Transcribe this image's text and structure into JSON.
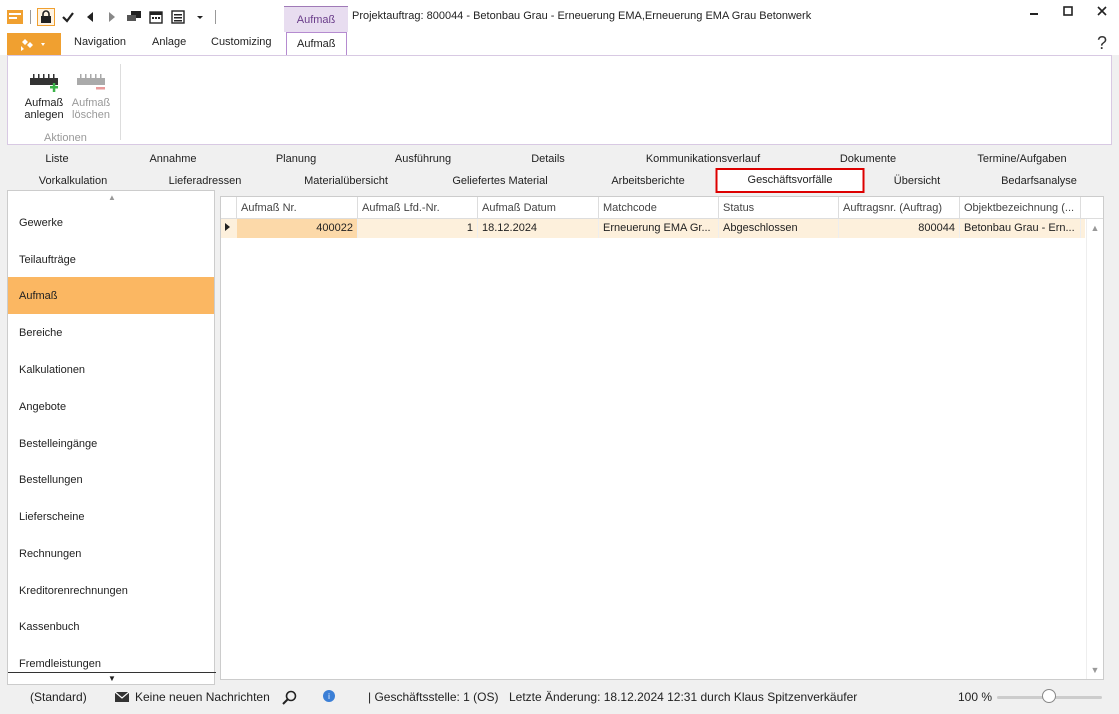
{
  "window": {
    "context_group": "Aufmaß",
    "title": "Projektauftrag: 800044 - Betonbau Grau - Erneuerung EMA,Erneuerung EMA Grau Betonwerk",
    "icons": [
      "app-icon",
      "lock-icon",
      "check-icon",
      "back-icon",
      "forward-icon",
      "chat-icon",
      "calendar-icon",
      "list-icon",
      "dropdown-icon"
    ],
    "controls": [
      "minimize-icon",
      "maximize-icon",
      "close-icon"
    ]
  },
  "ribbon": {
    "tabs": [
      "Navigation",
      "Anlage",
      "Customizing",
      "Aufmaß"
    ],
    "active_tab": "Aufmaß",
    "help": "?",
    "buttons": [
      {
        "label_1": "Aufmaß",
        "label_2": "anlegen",
        "enabled": true
      },
      {
        "label_1": "Aufmaß",
        "label_2": "löschen",
        "enabled": false
      }
    ],
    "group_label": "Aktionen"
  },
  "nav": {
    "row1": [
      "Liste",
      "Annahme",
      "Planung",
      "Ausführung",
      "Details",
      "Kommunikationsverlauf",
      "Dokumente",
      "Termine/Aufgaben"
    ],
    "row2": [
      "Vorkalkulation",
      "Lieferadressen",
      "Materialübersicht",
      "Geliefertes Material",
      "Arbeitsberichte",
      "Geschäftsvorfälle",
      "Übersicht",
      "Bedarfsanalyse"
    ],
    "selected": "Geschäftsvorfälle"
  },
  "sidebar": {
    "items": [
      "Gewerke",
      "Teilaufträge",
      "Aufmaß",
      "Bereiche",
      "Kalkulationen",
      "Angebote",
      "Bestelleingänge",
      "Bestellungen",
      "Lieferscheine",
      "Rechnungen",
      "Kreditorenrechnungen",
      "Kassenbuch",
      "Fremdleistungen"
    ],
    "active": "Aufmaß"
  },
  "grid": {
    "columns": [
      "Aufmaß Nr.",
      "Aufmaß Lfd.-Nr.",
      "Aufmaß Datum",
      "Matchcode",
      "Status",
      "Auftragsnr. (Auftrag)",
      "Objektbezeichnung (..."
    ],
    "rows": [
      [
        "400022",
        "1",
        "18.12.2024",
        "Erneuerung EMA Gr...",
        "Abgeschlossen",
        "800044",
        "Betonbau Grau - Ern..."
      ]
    ]
  },
  "status": {
    "layout": "(Standard)",
    "messages": "Keine neuen Nachrichten",
    "branch": "| Geschäftsstelle:  1 (OS)",
    "last_change": "Letzte Änderung: 18.12.2024 12:31 durch Klaus Spitzenverkäufer",
    "zoom": "100 %",
    "zoom_value": 100
  }
}
